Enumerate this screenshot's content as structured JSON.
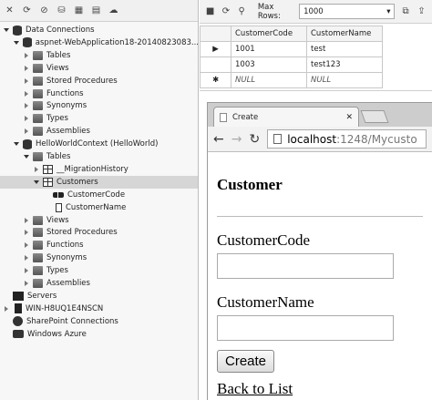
{
  "explorer": {
    "nodes": [
      {
        "label": "Data Connections",
        "level": 0,
        "expander": "down",
        "icon": "db",
        "name": "tree-data-connections"
      },
      {
        "label": "aspnet-WebApplication18-20140823083...",
        "level": 1,
        "expander": "down",
        "icon": "db",
        "name": "tree-aspnet-database"
      },
      {
        "label": "Tables",
        "level": 2,
        "expander": "right",
        "icon": "folder",
        "name": "tree-tables-1"
      },
      {
        "label": "Views",
        "level": 2,
        "expander": "right",
        "icon": "folder",
        "name": "tree-views-1"
      },
      {
        "label": "Stored Procedures",
        "level": 2,
        "expander": "right",
        "icon": "folder",
        "name": "tree-stored-procedures-1"
      },
      {
        "label": "Functions",
        "level": 2,
        "expander": "right",
        "icon": "folder",
        "name": "tree-functions-1"
      },
      {
        "label": "Synonyms",
        "level": 2,
        "expander": "right",
        "icon": "folder",
        "name": "tree-synonyms-1"
      },
      {
        "label": "Types",
        "level": 2,
        "expander": "right",
        "icon": "folder",
        "name": "tree-types-1"
      },
      {
        "label": "Assemblies",
        "level": 2,
        "expander": "right",
        "icon": "folder",
        "name": "tree-assemblies-1"
      },
      {
        "label": "HelloWorldContext (HelloWorld)",
        "level": 1,
        "expander": "down",
        "icon": "db",
        "name": "tree-helloworld-context"
      },
      {
        "label": "Tables",
        "level": 2,
        "expander": "down",
        "icon": "folder",
        "name": "tree-tables-2"
      },
      {
        "label": "__MigrationHistory",
        "level": 3,
        "expander": "right",
        "icon": "table",
        "name": "tree-migration-history"
      },
      {
        "label": "Customers",
        "level": 3,
        "expander": "down",
        "icon": "table",
        "name": "tree-customers",
        "selected": true
      },
      {
        "label": "CustomerCode",
        "level": 4,
        "expander": "none",
        "icon": "key",
        "name": "tree-customer-code"
      },
      {
        "label": "CustomerName",
        "level": 4,
        "expander": "none",
        "icon": "col",
        "name": "tree-customer-name"
      },
      {
        "label": "Views",
        "level": 2,
        "expander": "right",
        "icon": "folder",
        "name": "tree-views-2"
      },
      {
        "label": "Stored Procedures",
        "level": 2,
        "expander": "right",
        "icon": "folder",
        "name": "tree-stored-procedures-2"
      },
      {
        "label": "Functions",
        "level": 2,
        "expander": "right",
        "icon": "folder",
        "name": "tree-functions-2"
      },
      {
        "label": "Synonyms",
        "level": 2,
        "expander": "right",
        "icon": "folder",
        "name": "tree-synonyms-2"
      },
      {
        "label": "Types",
        "level": 2,
        "expander": "right",
        "icon": "folder",
        "name": "tree-types-2"
      },
      {
        "label": "Assemblies",
        "level": 2,
        "expander": "right",
        "icon": "folder",
        "name": "tree-assemblies-2"
      },
      {
        "label": "Servers",
        "level": 0,
        "expander": "none",
        "icon": "servers",
        "name": "tree-servers"
      },
      {
        "label": "WIN-H8UQ1E4NSCN",
        "level": 0,
        "expander": "right",
        "icon": "pc",
        "name": "tree-server-machine"
      },
      {
        "label": "SharePoint Connections",
        "level": 0,
        "expander": "none",
        "icon": "sp",
        "name": "tree-sharepoint-connections"
      },
      {
        "label": "Windows Azure",
        "level": 0,
        "expander": "none",
        "icon": "azure",
        "name": "tree-windows-azure"
      }
    ]
  },
  "grid": {
    "max_rows_label": "Max Rows:",
    "max_rows_value": "1000",
    "columns": [
      "CustomerCode",
      "CustomerName"
    ],
    "rows": [
      {
        "marker": "▶",
        "code": "1001",
        "name": "test",
        "null": false
      },
      {
        "marker": "",
        "code": "1003",
        "name": "test123",
        "null": false
      },
      {
        "marker": "✱",
        "code": "NULL",
        "name": "NULL",
        "null": true
      }
    ]
  },
  "browser": {
    "tab_title": "Create",
    "url_host": "localhost",
    "url_rest": ":1248/Mycusto",
    "heading": "Customer",
    "code_label": "CustomerCode",
    "name_label": "CustomerName",
    "create_button": "Create",
    "back_link": "Back to List"
  }
}
